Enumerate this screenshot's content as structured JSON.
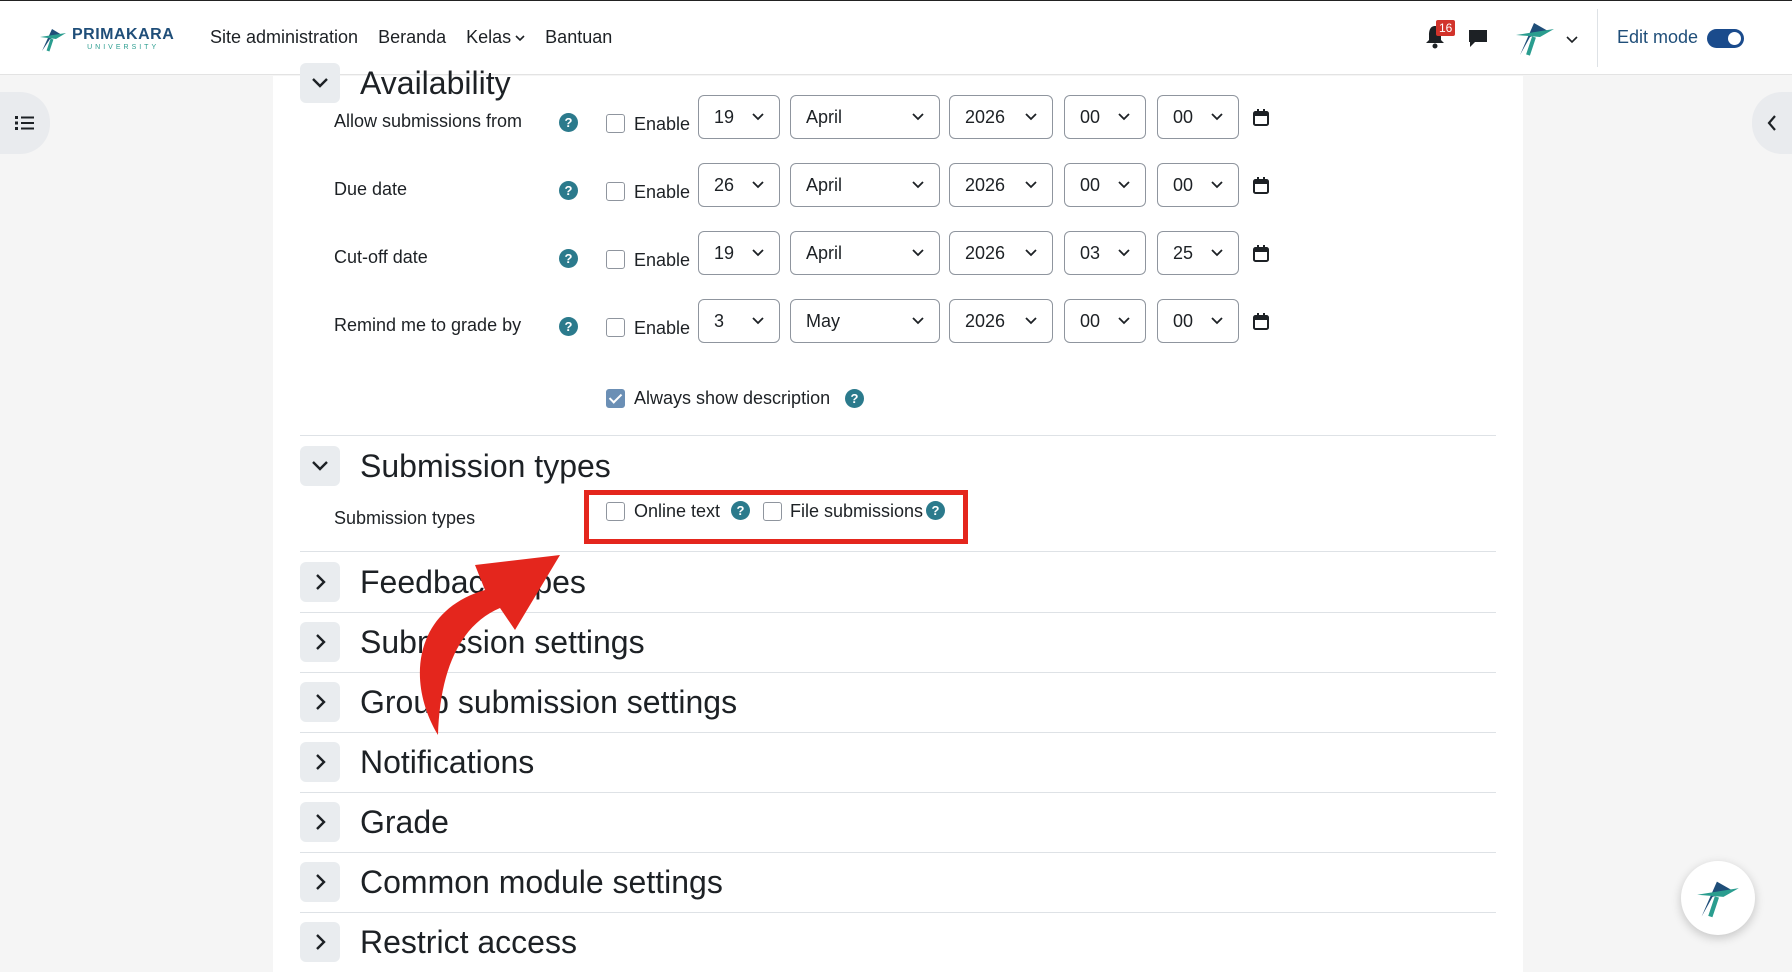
{
  "brand": {
    "name": "PRIMAKARA",
    "sub": "UNIVERSITY"
  },
  "nav": {
    "links": [
      {
        "label": "Site administration"
      },
      {
        "label": "Beranda"
      },
      {
        "label": "Kelas"
      },
      {
        "label": "Bantuan"
      }
    ],
    "notifications_count": "16",
    "edit_mode_label": "Edit mode",
    "edit_mode_on": true
  },
  "availability": {
    "title": "Availability",
    "rows": [
      {
        "label": "Allow submissions from",
        "enable_label": "Enable",
        "enabled": false,
        "day": "19",
        "month": "April",
        "year": "2026",
        "hour": "00",
        "minute": "00"
      },
      {
        "label": "Due date",
        "enable_label": "Enable",
        "enabled": false,
        "day": "26",
        "month": "April",
        "year": "2026",
        "hour": "00",
        "minute": "00"
      },
      {
        "label": "Cut-off date",
        "enable_label": "Enable",
        "enabled": false,
        "day": "19",
        "month": "April",
        "year": "2026",
        "hour": "03",
        "minute": "25"
      },
      {
        "label": "Remind me to grade by",
        "enable_label": "Enable",
        "enabled": false,
        "day": "3",
        "month": "May",
        "year": "2026",
        "hour": "00",
        "minute": "00"
      }
    ],
    "always_show_description": {
      "label": "Always show description",
      "checked": true
    }
  },
  "submission_types": {
    "title": "Submission types",
    "row_label": "Submission types",
    "options": [
      {
        "label": "Online text",
        "checked": false
      },
      {
        "label": "File submissions",
        "checked": false
      }
    ]
  },
  "collapsed_sections": [
    {
      "title": "Feedback types"
    },
    {
      "title": "Submission settings"
    },
    {
      "title": "Group submission settings"
    },
    {
      "title": "Notifications"
    },
    {
      "title": "Grade"
    },
    {
      "title": "Common module settings"
    },
    {
      "title": "Restrict access"
    }
  ],
  "colors": {
    "help": "#2b7a8c",
    "accent": "#1a4b8c",
    "highlight": "#e4261d"
  }
}
